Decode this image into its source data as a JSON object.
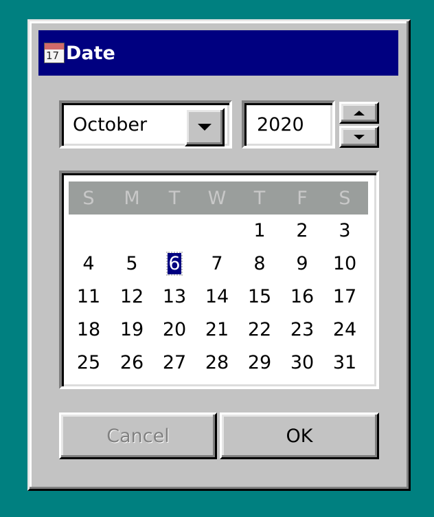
{
  "window": {
    "title": "Date",
    "icon": "calendar-icon",
    "icon_text": "17"
  },
  "month_select": {
    "value": "October"
  },
  "year_field": {
    "value": "2020"
  },
  "calendar": {
    "weekdays": [
      "S",
      "M",
      "T",
      "W",
      "T",
      "F",
      "S"
    ],
    "first_weekday_index": 4,
    "days_in_month": 31,
    "selected_day": 6
  },
  "buttons": {
    "cancel": "Cancel",
    "ok": "OK"
  },
  "colors": {
    "titlebar": "#000080",
    "desktop": "#008080",
    "face": "#c3c3c3"
  }
}
